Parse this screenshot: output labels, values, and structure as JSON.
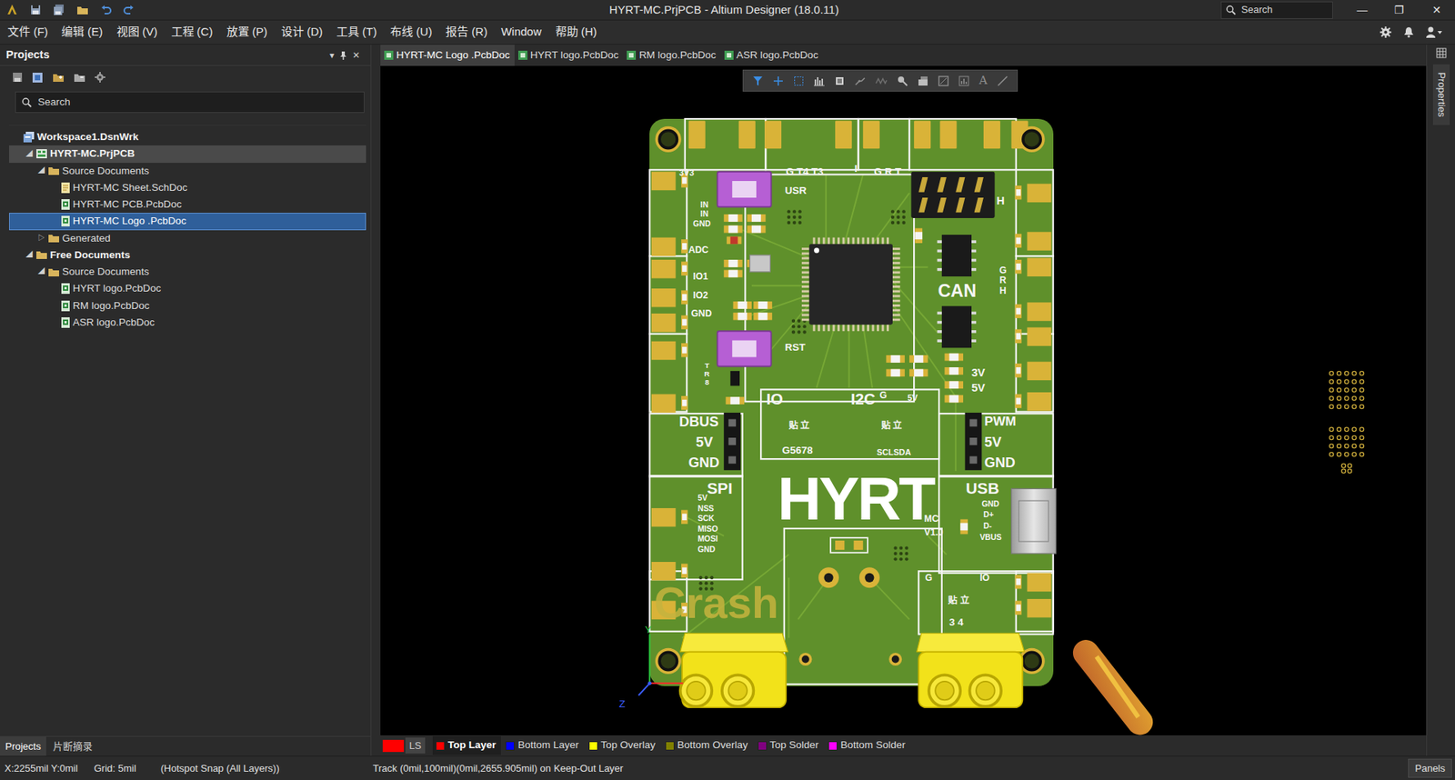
{
  "window": {
    "title": "HYRT-MC.PrjPCB - Altium Designer (18.0.11)",
    "search": {
      "placeholder": "Search"
    },
    "controls": [
      "—",
      "❐",
      "✕"
    ]
  },
  "menu": {
    "items": [
      "文件 (F)",
      "编辑 (E)",
      "视图 (V)",
      "工程 (C)",
      "放置 (P)",
      "设计 (D)",
      "工具 (T)",
      "布线 (U)",
      "报告 (R)",
      "Window",
      "帮助 (H)"
    ]
  },
  "panel": {
    "title": "Projects",
    "buttons": [
      "▾",
      "✕"
    ],
    "search": {
      "placeholder": "Search"
    },
    "tree": [
      {
        "label": "Workspace1.DsnWrk",
        "kind": "workspace",
        "depth": 0,
        "selected": false,
        "focused": false
      },
      {
        "label": "HYRT-MC.PrjPCB",
        "kind": "project",
        "depth": 0,
        "toggle": "◢",
        "expanded": true,
        "selected": false,
        "focused": true
      },
      {
        "label": "Source Documents",
        "kind": "folder",
        "depth": 1,
        "toggle": "◢",
        "expanded": true,
        "selected": false,
        "focused": false
      },
      {
        "label": "HYRT-MC Sheet.SchDoc",
        "kind": "sch",
        "depth": 2,
        "selected": false,
        "focused": false
      },
      {
        "label": "HYRT-MC PCB.PcbDoc",
        "kind": "pcb",
        "depth": 2,
        "selected": false,
        "focused": false
      },
      {
        "label": "HYRT-MC Logo .PcbDoc",
        "kind": "pcb",
        "depth": 2,
        "selected": true,
        "focused": false
      },
      {
        "label": "Generated",
        "kind": "folder",
        "depth": 1,
        "toggle": "▷",
        "expanded": false,
        "selected": false,
        "focused": false
      },
      {
        "label": "Free Documents",
        "kind": "group",
        "depth": 0,
        "toggle": "◢",
        "expanded": true,
        "selected": false,
        "focused": false
      },
      {
        "label": "Source Documents",
        "kind": "folder",
        "depth": 1,
        "toggle": "◢",
        "expanded": true,
        "selected": false,
        "focused": false
      },
      {
        "label": "HYRT logo.PcbDoc",
        "kind": "pcb",
        "depth": 2,
        "selected": false,
        "focused": false
      },
      {
        "label": "RM logo.PcbDoc",
        "kind": "pcb",
        "depth": 2,
        "selected": false,
        "focused": false
      },
      {
        "label": "ASR logo.PcbDoc",
        "kind": "pcb",
        "depth": 2,
        "selected": false,
        "focused": false
      }
    ],
    "bottom_tabs": [
      {
        "label": "Projects",
        "selected": true
      },
      {
        "label": "片断摘录",
        "selected": false
      }
    ]
  },
  "doc_tabs": [
    {
      "label": "HYRT-MC Logo .PcbDoc",
      "selected": true
    },
    {
      "label": "HYRT logo.PcbDoc",
      "selected": false
    },
    {
      "label": "RM logo.PcbDoc",
      "selected": false
    },
    {
      "label": "ASR logo.PcbDoc",
      "selected": false
    }
  ],
  "canvas_toolbar": {
    "text_tool": "A"
  },
  "layers": {
    "current_color": "#ff0000",
    "ls": "LS",
    "items": [
      {
        "label": "Top Layer",
        "color": "#ff0000",
        "selected": true
      },
      {
        "label": "Bottom Layer",
        "color": "#0000ff",
        "selected": false
      },
      {
        "label": "Top Overlay",
        "color": "#ffff00",
        "selected": false
      },
      {
        "label": "Bottom Overlay",
        "color": "#808000",
        "selected": false
      },
      {
        "label": "Top Solder",
        "color": "#800080",
        "selected": false
      },
      {
        "label": "Bottom Solder",
        "color": "#ff00ff",
        "selected": false
      }
    ]
  },
  "status_bar": {
    "coords": "X:2255mil Y:0mil",
    "grid": "Grid: 5mil",
    "snap": "(Hotspot Snap (All Layers))",
    "info": "Track (0mil,100mil)(0mil,2655.905mil) on Keep-Out Layer",
    "panels": "Panels"
  },
  "side_strip": {
    "label": "Properties"
  },
  "board": {
    "labels": [
      "3V3",
      "USR",
      "G T4 T3",
      "I",
      "G R T",
      "IN",
      "IN",
      "GND",
      "ADC",
      "IO1",
      "IO2",
      "GND",
      "RST",
      "TR8",
      "CAN",
      "H",
      "GRH",
      "3V",
      "5V",
      "IO",
      "I2C",
      "G",
      "5V",
      "贴 立",
      "贴 立",
      "G5678",
      "SCLSDA",
      "DBUS",
      "5V",
      "GND",
      "PWM",
      "5V",
      "GND",
      "SPI",
      "5V",
      "NSS",
      "SCK",
      "MISO",
      "MOSI",
      "GND",
      "USB",
      "GND",
      "D+",
      "D-",
      "VBUS",
      "MC",
      "V1.0",
      "G",
      "IO",
      "贴 立",
      "3 4"
    ],
    "logo": "HYRT",
    "signature": "Crash",
    "axis": [
      "Y",
      "Z"
    ]
  }
}
